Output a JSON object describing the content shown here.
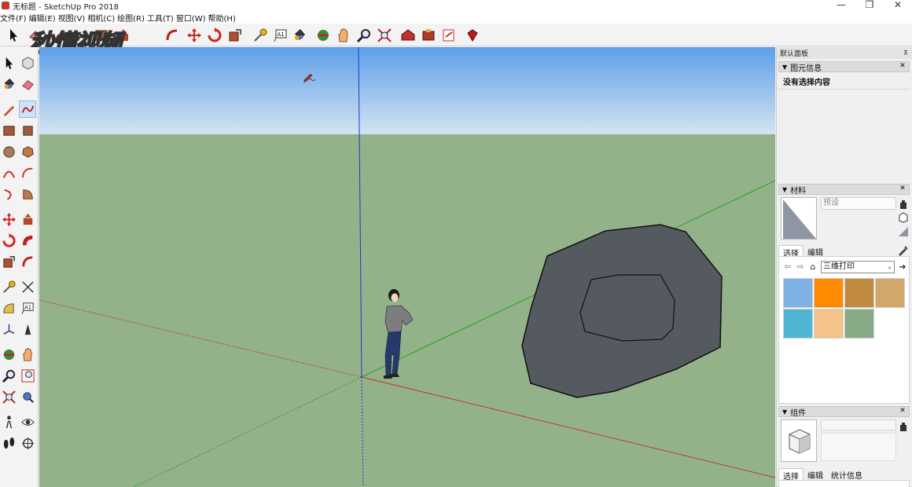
{
  "window": {
    "title": "无标题 - SketchUp Pro 2018",
    "controls": {
      "minimize": "—",
      "restore": "❐",
      "close": "✕"
    }
  },
  "menu": [
    "文件(F)",
    "编辑(E)",
    "视图(V)",
    "相机(C)",
    "绘图(R)",
    "工具(T)",
    "窗口(W)",
    "帮助(H)"
  ],
  "watermark": {
    "text": "秒懂视频"
  },
  "right_panel": {
    "tray_title": "默认面板",
    "tray_pin": "⊼",
    "entity_info": {
      "header": "图元信息",
      "status": "没有选择内容"
    },
    "materials": {
      "header": "材料",
      "name_placeholder": "预设",
      "tabs": [
        "选择",
        "编辑"
      ],
      "collection": "三维打印",
      "swatch_colors": [
        "#7fb2e2",
        "#ff8a00",
        "#c08a3e",
        "#d2a86a",
        "#4fb5d0",
        "#f4c38a",
        "#86ab86"
      ]
    },
    "components": {
      "header": "组件",
      "tabs": [
        "选择",
        "编辑",
        "统计信息"
      ]
    }
  },
  "colors": {
    "sky_top": "#5d9fe8",
    "sky_bottom": "#d4e4f2",
    "ground": "#93b28a",
    "model_fill": "#555a60",
    "axis_red": "#c0392b",
    "axis_green": "#22a022",
    "axis_blue": "#2233dd"
  }
}
